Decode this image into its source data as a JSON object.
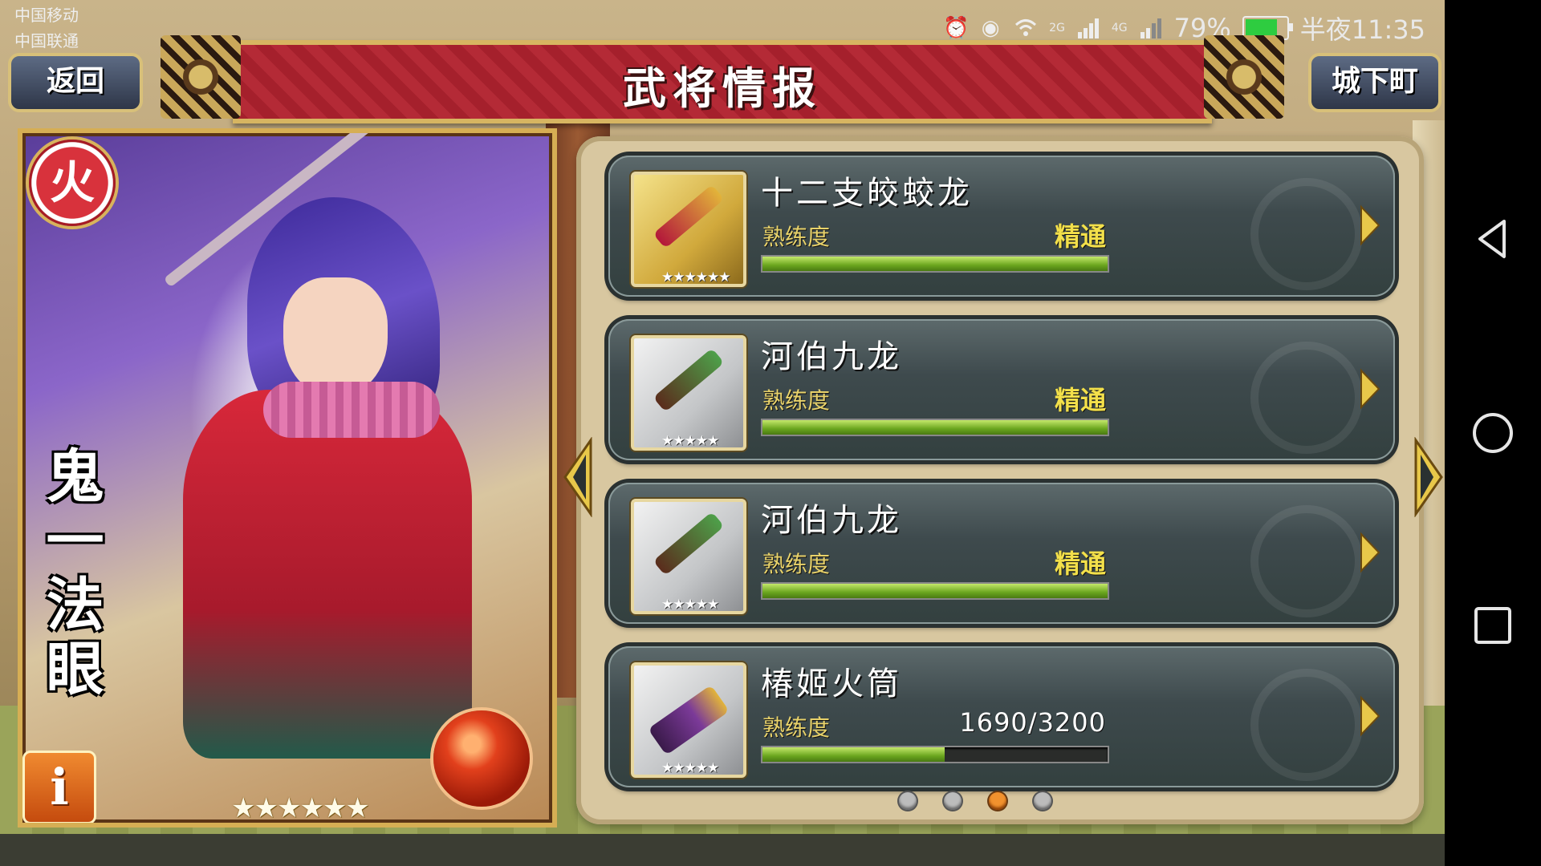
{
  "status_bar": {
    "carrier_1": "中国移动",
    "carrier_2": "中国联通",
    "network_2g": "2G",
    "network_4g": "4G",
    "battery": "79%",
    "time": "半夜11:35"
  },
  "header": {
    "title": "武将情报",
    "back_label": "返回",
    "town_label": "城下町"
  },
  "character": {
    "element": "火",
    "name": "鬼一法眼",
    "info_label": "i",
    "rarity_stars": "★★★★★★"
  },
  "weapons": [
    {
      "name": "十二支皎蛟龙",
      "prof_label": "熟练度",
      "prof_value": "精通",
      "progress": 1.0,
      "stars": "★★★★★★",
      "frame": "gold"
    },
    {
      "name": "河伯九龙",
      "prof_label": "熟练度",
      "prof_value": "精通",
      "progress": 1.0,
      "stars": "★★★★★",
      "frame": "silver"
    },
    {
      "name": "河伯九龙",
      "prof_label": "熟练度",
      "prof_value": "精通",
      "progress": 1.0,
      "stars": "★★★★★",
      "frame": "silver"
    },
    {
      "name": "椿姬火筒",
      "prof_label": "熟练度",
      "prof_value": "1690/3200",
      "progress": 0.528,
      "stars": "★★★★★",
      "frame": "silver"
    }
  ],
  "pager": {
    "count": 4,
    "active": 2
  },
  "colors": {
    "accent_gold": "#d6ae54",
    "banner_red": "#a5202c",
    "bar_green": "#6aa51e",
    "active_dot": "#f1922e"
  }
}
